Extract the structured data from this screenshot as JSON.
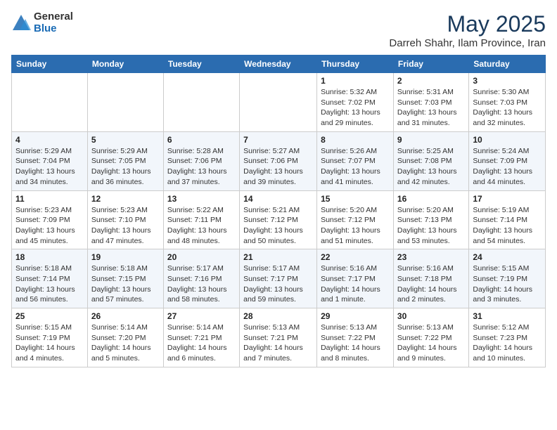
{
  "logo": {
    "general": "General",
    "blue": "Blue"
  },
  "title": "May 2025",
  "subtitle": "Darreh Shahr, Ilam Province, Iran",
  "headers": [
    "Sunday",
    "Monday",
    "Tuesday",
    "Wednesday",
    "Thursday",
    "Friday",
    "Saturday"
  ],
  "weeks": [
    [
      {
        "day": "",
        "info": ""
      },
      {
        "day": "",
        "info": ""
      },
      {
        "day": "",
        "info": ""
      },
      {
        "day": "",
        "info": ""
      },
      {
        "day": "1",
        "info": "Sunrise: 5:32 AM\nSunset: 7:02 PM\nDaylight: 13 hours\nand 29 minutes."
      },
      {
        "day": "2",
        "info": "Sunrise: 5:31 AM\nSunset: 7:03 PM\nDaylight: 13 hours\nand 31 minutes."
      },
      {
        "day": "3",
        "info": "Sunrise: 5:30 AM\nSunset: 7:03 PM\nDaylight: 13 hours\nand 32 minutes."
      }
    ],
    [
      {
        "day": "4",
        "info": "Sunrise: 5:29 AM\nSunset: 7:04 PM\nDaylight: 13 hours\nand 34 minutes."
      },
      {
        "day": "5",
        "info": "Sunrise: 5:29 AM\nSunset: 7:05 PM\nDaylight: 13 hours\nand 36 minutes."
      },
      {
        "day": "6",
        "info": "Sunrise: 5:28 AM\nSunset: 7:06 PM\nDaylight: 13 hours\nand 37 minutes."
      },
      {
        "day": "7",
        "info": "Sunrise: 5:27 AM\nSunset: 7:06 PM\nDaylight: 13 hours\nand 39 minutes."
      },
      {
        "day": "8",
        "info": "Sunrise: 5:26 AM\nSunset: 7:07 PM\nDaylight: 13 hours\nand 41 minutes."
      },
      {
        "day": "9",
        "info": "Sunrise: 5:25 AM\nSunset: 7:08 PM\nDaylight: 13 hours\nand 42 minutes."
      },
      {
        "day": "10",
        "info": "Sunrise: 5:24 AM\nSunset: 7:09 PM\nDaylight: 13 hours\nand 44 minutes."
      }
    ],
    [
      {
        "day": "11",
        "info": "Sunrise: 5:23 AM\nSunset: 7:09 PM\nDaylight: 13 hours\nand 45 minutes."
      },
      {
        "day": "12",
        "info": "Sunrise: 5:23 AM\nSunset: 7:10 PM\nDaylight: 13 hours\nand 47 minutes."
      },
      {
        "day": "13",
        "info": "Sunrise: 5:22 AM\nSunset: 7:11 PM\nDaylight: 13 hours\nand 48 minutes."
      },
      {
        "day": "14",
        "info": "Sunrise: 5:21 AM\nSunset: 7:12 PM\nDaylight: 13 hours\nand 50 minutes."
      },
      {
        "day": "15",
        "info": "Sunrise: 5:20 AM\nSunset: 7:12 PM\nDaylight: 13 hours\nand 51 minutes."
      },
      {
        "day": "16",
        "info": "Sunrise: 5:20 AM\nSunset: 7:13 PM\nDaylight: 13 hours\nand 53 minutes."
      },
      {
        "day": "17",
        "info": "Sunrise: 5:19 AM\nSunset: 7:14 PM\nDaylight: 13 hours\nand 54 minutes."
      }
    ],
    [
      {
        "day": "18",
        "info": "Sunrise: 5:18 AM\nSunset: 7:14 PM\nDaylight: 13 hours\nand 56 minutes."
      },
      {
        "day": "19",
        "info": "Sunrise: 5:18 AM\nSunset: 7:15 PM\nDaylight: 13 hours\nand 57 minutes."
      },
      {
        "day": "20",
        "info": "Sunrise: 5:17 AM\nSunset: 7:16 PM\nDaylight: 13 hours\nand 58 minutes."
      },
      {
        "day": "21",
        "info": "Sunrise: 5:17 AM\nSunset: 7:17 PM\nDaylight: 13 hours\nand 59 minutes."
      },
      {
        "day": "22",
        "info": "Sunrise: 5:16 AM\nSunset: 7:17 PM\nDaylight: 14 hours\nand 1 minute."
      },
      {
        "day": "23",
        "info": "Sunrise: 5:16 AM\nSunset: 7:18 PM\nDaylight: 14 hours\nand 2 minutes."
      },
      {
        "day": "24",
        "info": "Sunrise: 5:15 AM\nSunset: 7:19 PM\nDaylight: 14 hours\nand 3 minutes."
      }
    ],
    [
      {
        "day": "25",
        "info": "Sunrise: 5:15 AM\nSunset: 7:19 PM\nDaylight: 14 hours\nand 4 minutes."
      },
      {
        "day": "26",
        "info": "Sunrise: 5:14 AM\nSunset: 7:20 PM\nDaylight: 14 hours\nand 5 minutes."
      },
      {
        "day": "27",
        "info": "Sunrise: 5:14 AM\nSunset: 7:21 PM\nDaylight: 14 hours\nand 6 minutes."
      },
      {
        "day": "28",
        "info": "Sunrise: 5:13 AM\nSunset: 7:21 PM\nDaylight: 14 hours\nand 7 minutes."
      },
      {
        "day": "29",
        "info": "Sunrise: 5:13 AM\nSunset: 7:22 PM\nDaylight: 14 hours\nand 8 minutes."
      },
      {
        "day": "30",
        "info": "Sunrise: 5:13 AM\nSunset: 7:22 PM\nDaylight: 14 hours\nand 9 minutes."
      },
      {
        "day": "31",
        "info": "Sunrise: 5:12 AM\nSunset: 7:23 PM\nDaylight: 14 hours\nand 10 minutes."
      }
    ]
  ]
}
